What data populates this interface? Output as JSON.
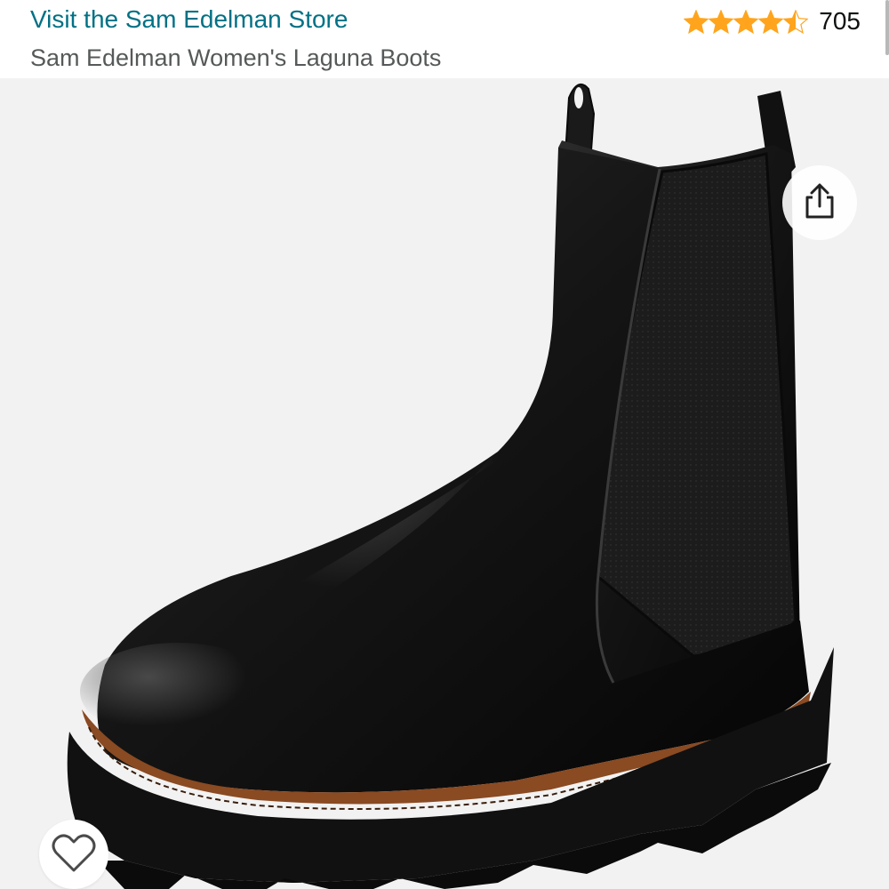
{
  "header": {
    "store_link": "Visit the Sam Edelman Store",
    "product_title": "Sam Edelman Women's Laguna Boots"
  },
  "rating": {
    "stars": 4.5,
    "max_stars": 5,
    "review_count": "705",
    "star_color": "#ffa41c"
  },
  "image": {
    "icon": "boot-image",
    "image_bg": "#f2f2f2"
  },
  "actions": {
    "share_icon": "share-icon",
    "wishlist_icon": "heart-icon"
  },
  "colors": {
    "link": "#007185",
    "subtitle": "#565959",
    "text": "#0f1111"
  }
}
